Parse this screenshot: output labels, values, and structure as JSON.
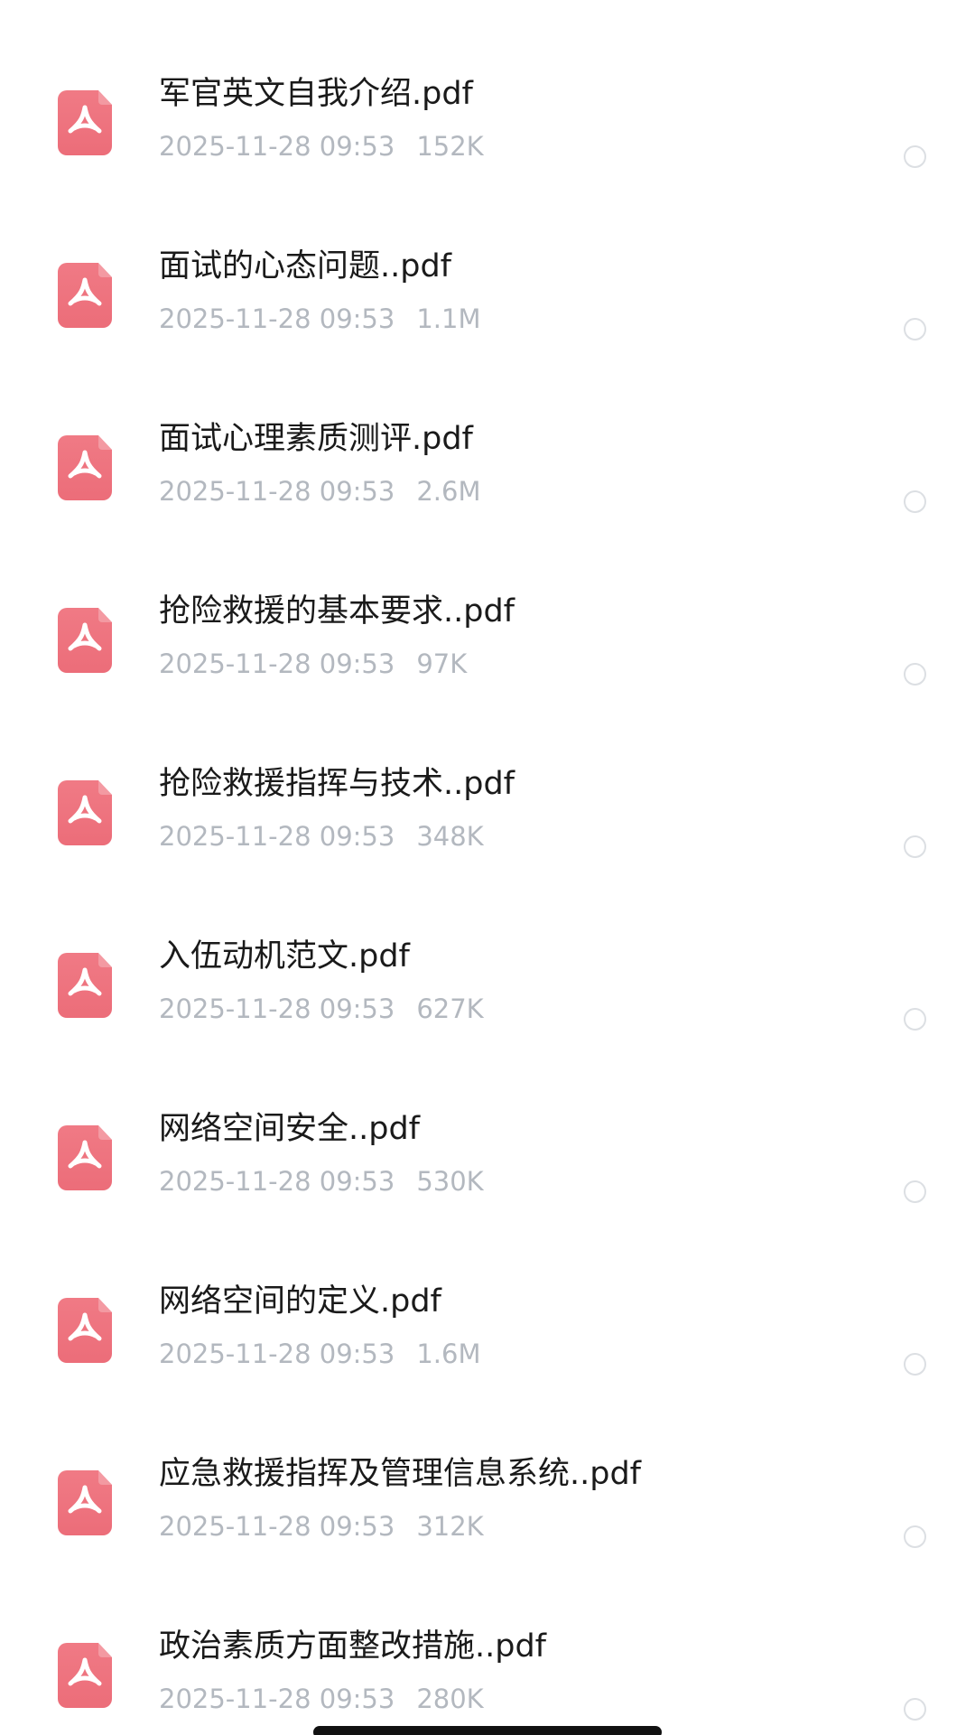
{
  "files": [
    {
      "name": "军官英文自我介绍.pdf",
      "date": "2025-11-28 09:53",
      "size": "152K",
      "icon": "pdf-icon"
    },
    {
      "name": "面试的心态问题..pdf",
      "date": "2025-11-28 09:53",
      "size": "1.1M",
      "icon": "pdf-icon"
    },
    {
      "name": "面试心理素质测评.pdf",
      "date": "2025-11-28 09:53",
      "size": "2.6M",
      "icon": "pdf-icon"
    },
    {
      "name": "抢险救援的基本要求..pdf",
      "date": "2025-11-28 09:53",
      "size": "97K",
      "icon": "pdf-icon"
    },
    {
      "name": "抢险救援指挥与技术..pdf",
      "date": "2025-11-28 09:53",
      "size": "348K",
      "icon": "pdf-icon"
    },
    {
      "name": "入伍动机范文.pdf",
      "date": "2025-11-28 09:53",
      "size": "627K",
      "icon": "pdf-icon"
    },
    {
      "name": "网络空间安全..pdf",
      "date": "2025-11-28 09:53",
      "size": "530K",
      "icon": "pdf-icon"
    },
    {
      "name": "网络空间的定义.pdf",
      "date": "2025-11-28 09:53",
      "size": "1.6M",
      "icon": "pdf-icon"
    },
    {
      "name": "应急救援指挥及管理信息系统..pdf",
      "date": "2025-11-28 09:53",
      "size": "312K",
      "icon": "pdf-icon"
    },
    {
      "name": "政治素质方面整改措施..pdf",
      "date": "2025-11-28 09:53",
      "size": "280K",
      "icon": "pdf-icon"
    }
  ],
  "colors": {
    "pdf_icon": "#ec6d79",
    "filename": "#1a1a1a",
    "meta": "#b3b8bf",
    "radio_border": "#dcdfe3",
    "home_indicator": "#111111"
  }
}
